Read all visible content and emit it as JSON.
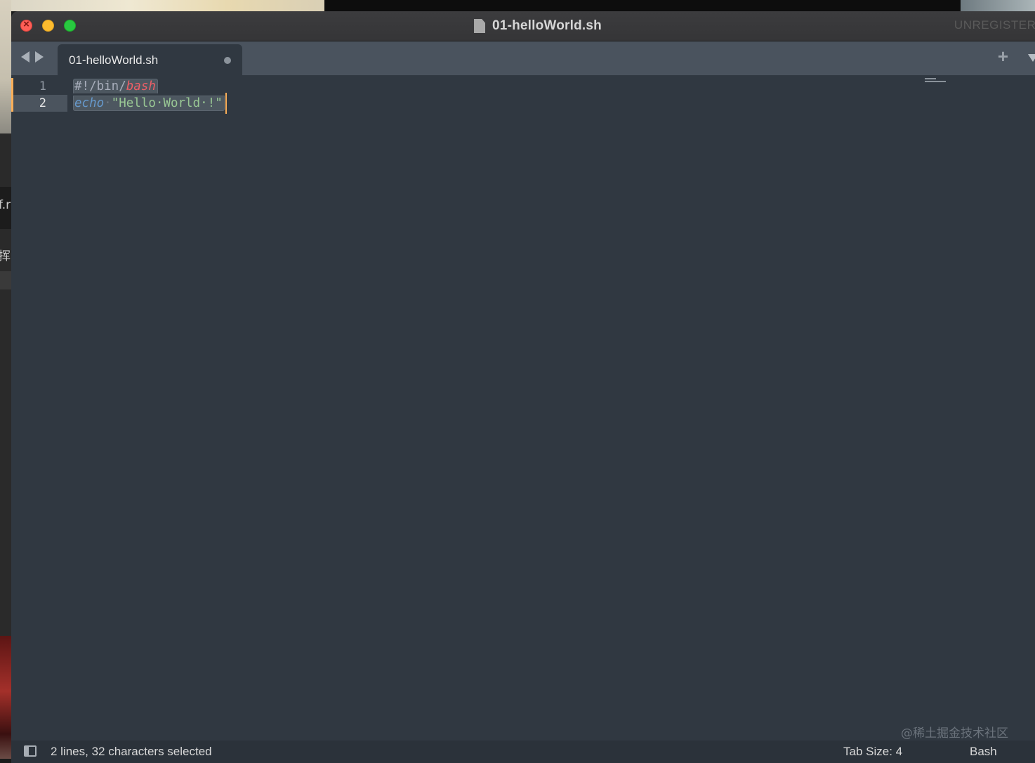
{
  "window": {
    "title": "01-helloWorld.sh",
    "license_notice": "UNREGISTERED"
  },
  "tabs": [
    {
      "label": "01-helloWorld.sh",
      "modified": true
    }
  ],
  "editor": {
    "lines": [
      {
        "number": "1",
        "parts": [
          "#!/bin/",
          "bash"
        ]
      },
      {
        "number": "2",
        "parts": [
          "echo",
          "·",
          "\"Hello·World·!\""
        ]
      }
    ]
  },
  "statusbar": {
    "selection": "2 lines, 32 characters selected",
    "tab_size": "Tab Size: 4",
    "syntax": "Bash"
  },
  "desktop": {
    "fragment_1": "f.r",
    "fragment_2": "挥"
  },
  "watermark": "@稀土掘金技术社区",
  "colors": {
    "editor_bg": "#303841",
    "accent_caret": "#f9ae58",
    "keyword": "#6699cc",
    "string": "#99c794",
    "shebang_interp": "#ec5f67"
  }
}
